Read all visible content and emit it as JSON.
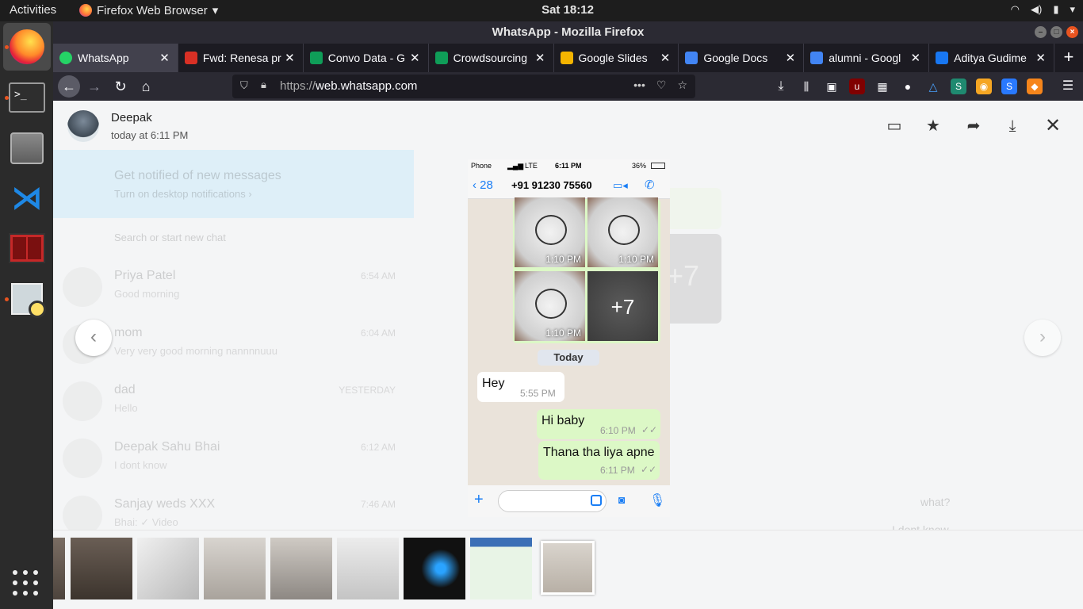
{
  "system": {
    "activities": "Activities",
    "app_name": "Firefox Web Browser",
    "clock": "Sat 18:12"
  },
  "window": {
    "title": "WhatsApp - Mozilla Firefox"
  },
  "tabs": [
    {
      "label": "WhatsApp",
      "color": "#25d366"
    },
    {
      "label": "Fwd: Renesa pr",
      "color": "#d93025"
    },
    {
      "label": "Convo Data - G",
      "color": "#0f9d58"
    },
    {
      "label": "Crowdsourcing",
      "color": "#0f9d58"
    },
    {
      "label": "Google Slides",
      "color": "#f4b400"
    },
    {
      "label": "Google Docs",
      "color": "#4285f4"
    },
    {
      "label": "alumni - Googl",
      "color": "#4285f4"
    },
    {
      "label": "Aditya Gudime",
      "color": "#1877f2"
    }
  ],
  "nav": {
    "url_display": "https://web.whatsapp.com",
    "url_prefix": "https://",
    "url_domain": "web.whatsapp.com",
    "more": "•••"
  },
  "viewer": {
    "sender": "Deepak",
    "timestamp": "today at 6:11 PM"
  },
  "background_chats": {
    "notify_title": "Get notified of new messages",
    "notify_sub": "Turn on desktop notifications ›",
    "search_hint": "Search or start new chat",
    "items": [
      {
        "name": "Priya Patel",
        "message": "Good morning",
        "time": "6:54 AM"
      },
      {
        "name": "mom",
        "message": "Very very good morning nannnnuuu",
        "time": "6:04 AM"
      },
      {
        "name": "dad",
        "message": "Hello",
        "time": "YESTERDAY"
      },
      {
        "name": "Deepak Sahu Bhai",
        "message": "I dont know",
        "time": "6:12 AM"
      },
      {
        "name": "Sanjay weds XXX",
        "message": "Bhai: ✓ Video",
        "time": "7:46 AM"
      }
    ]
  },
  "phone": {
    "carrier": "Phone",
    "network": "LTE",
    "time": "6:11 PM",
    "battery": "36%",
    "back_count": "28",
    "contact": "+91 91230 75560",
    "photo_times": [
      "1:10 PM",
      "1:10 PM",
      "1:10 PM"
    ],
    "more_count": "+7",
    "day_label": "Today",
    "messages": [
      {
        "text": "Hey",
        "time": "5:55 PM",
        "dir": "in"
      },
      {
        "text": "Hi baby",
        "time": "6:10 PM",
        "dir": "out"
      },
      {
        "text": "Thana tha liya apne",
        "time": "6:11 PM",
        "dir": "out"
      }
    ]
  },
  "ghost_right": {
    "what": "what?",
    "dont_know": "I dont know",
    "seven": "+7"
  },
  "colors": {
    "accent": "#1a7ef5",
    "bubble_out": "#dcf8c6",
    "ubuntu_orange": "#e95420"
  }
}
